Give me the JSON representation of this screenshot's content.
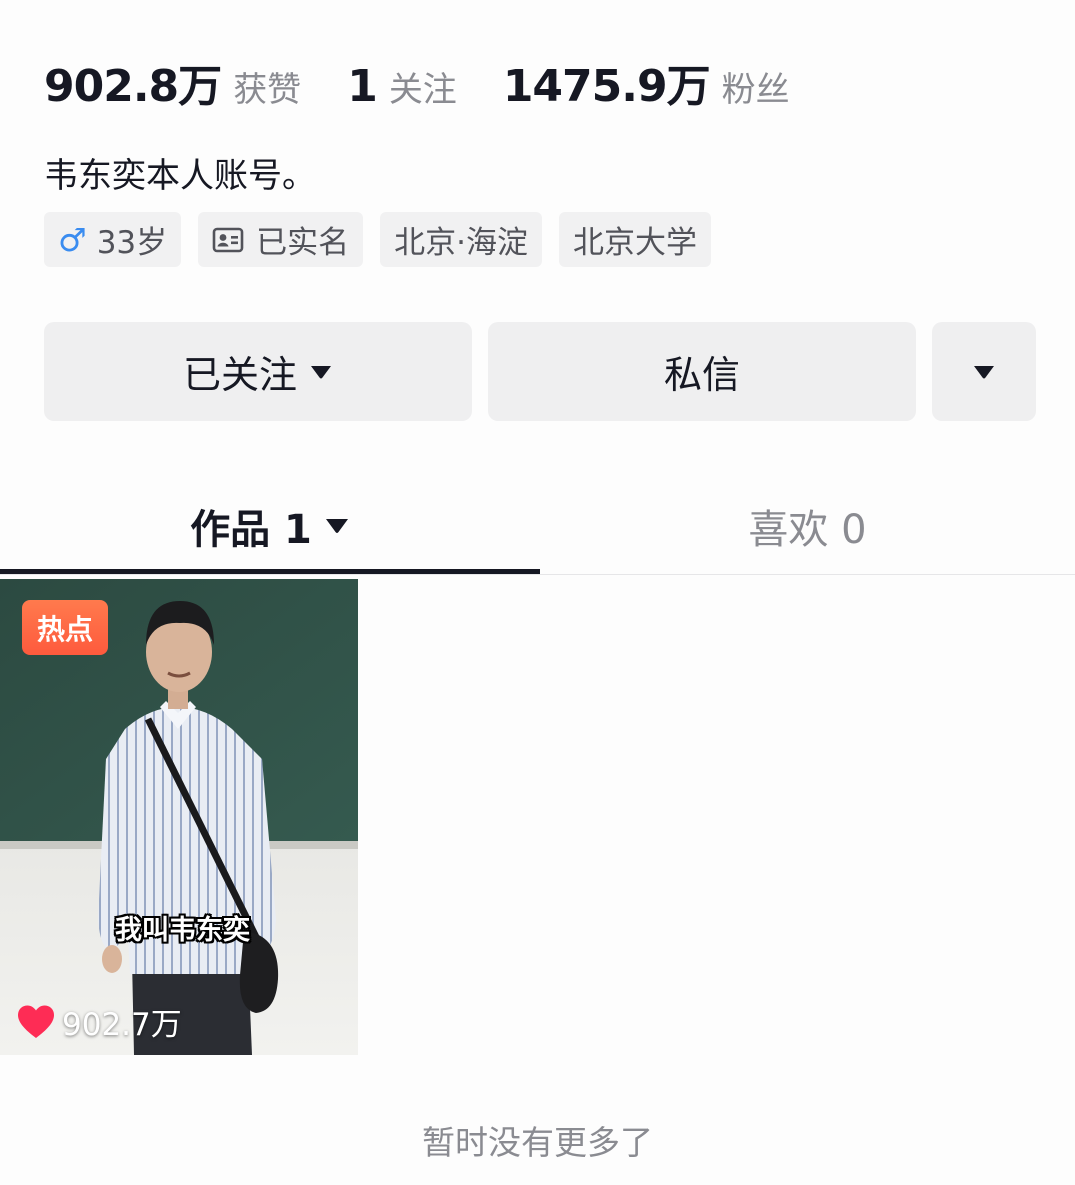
{
  "stats": [
    {
      "value": "902.8万",
      "label": "获赞"
    },
    {
      "value": "1",
      "label": "关注"
    },
    {
      "value": "1475.9万",
      "label": "粉丝"
    }
  ],
  "bio": "韦东奕本人账号。",
  "tags": {
    "age": "33岁",
    "verified": "已实名",
    "location": "北京·海淀",
    "school": "北京大学",
    "gender_icon": "male-icon",
    "verified_icon": "id-card-icon"
  },
  "actions": {
    "follow_label": "已关注",
    "message_label": "私信"
  },
  "tabs": [
    {
      "label": "作品 1",
      "active": true
    },
    {
      "label": "喜欢 0",
      "active": false
    }
  ],
  "video": {
    "badge": "热点",
    "subtitle": "我叫韦东奕",
    "likes": "902.7万"
  },
  "footer": "暂时没有更多了",
  "colors": {
    "text": "#161823",
    "secondary": "#8a8b91",
    "button_bg": "#efeff0",
    "badge": "#fe5a3d",
    "heart": "#fe2c55",
    "male": "#3a8cf0"
  }
}
